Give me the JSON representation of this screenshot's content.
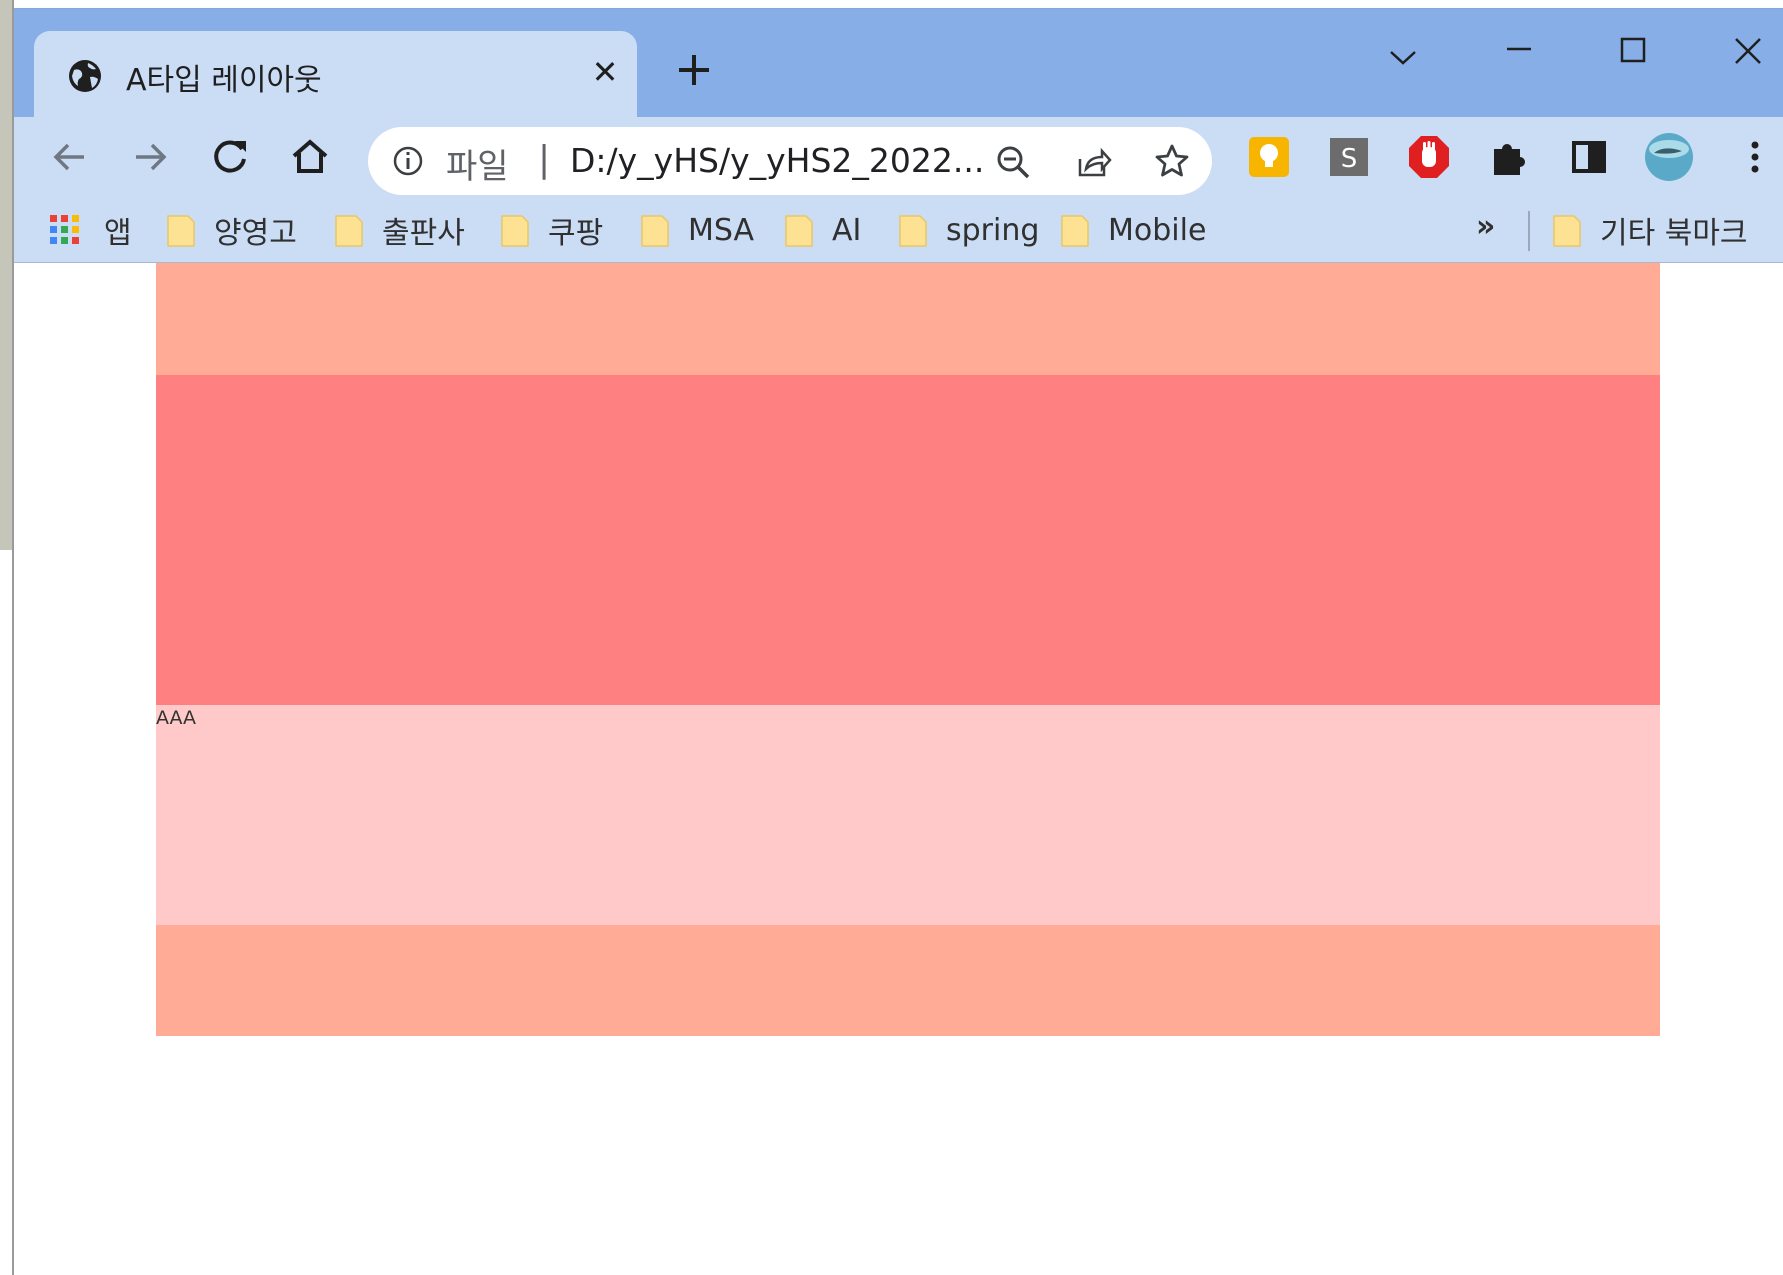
{
  "browser": {
    "tab": {
      "title": "A타입 레이아웃",
      "close": "✕"
    },
    "new_tab": "+",
    "window_controls": {
      "tab_search": "chevron-down-icon",
      "minimize": "minimize-icon",
      "maximize": "maximize-icon",
      "close": "close-icon"
    }
  },
  "toolbar": {
    "omnibox": {
      "scheme": "파일",
      "separator": "|",
      "url": "D:/y_yHS/y_yHS2_2022..."
    },
    "extensions": [
      "lightbulb-extension-icon",
      "s-extension-icon",
      "stop-hand-extension-icon",
      "puzzle-extensions-icon",
      "side-panel-icon",
      "profile-avatar"
    ]
  },
  "bookmarks": {
    "apps": "앱",
    "items": [
      "양영고",
      "출판사",
      "쿠팡",
      "MSA",
      "AI",
      "spring",
      "Mobile"
    ],
    "more": "»",
    "other": "기타 북마크"
  },
  "page": {
    "content_text": "AAA",
    "colors": {
      "header": "#ffab96",
      "main": "#ff8080",
      "content": "#ffc9c9",
      "footer": "#ffab96"
    }
  }
}
